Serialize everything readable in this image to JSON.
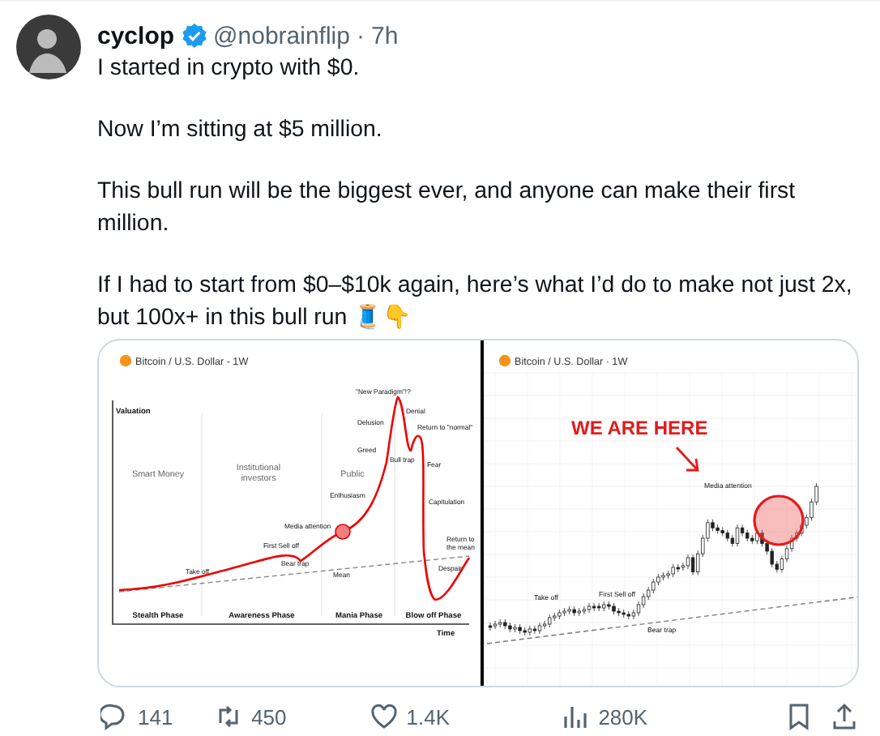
{
  "author": {
    "name": "cyclop",
    "verified": true,
    "handle": "@nobrainflip",
    "dot": "·",
    "time": "7h"
  },
  "paragraphs": [
    "I started in crypto with $0.",
    "Now I’m sitting at $5 million.",
    "This bull run will be the biggest ever, and anyone can make their first million.",
    "If I had to start from $0–$10k again, here’s what I’d do to make not just 2x, but 100x+ in this bull run 🧵👇"
  ],
  "media": [
    {
      "kind": "cycle",
      "title": "Bitcoin / U.S. Dollar - 1W",
      "ylabel": "Valuation",
      "xlabel": "Time",
      "groups": [
        "Smart Money",
        "Institutional investors",
        "Public"
      ],
      "phases": [
        "Stealth Phase",
        "Awareness Phase",
        "Mania Phase",
        "Blow off Phase"
      ],
      "annotations": [
        "\"New Paradigm\"!?",
        "Denial",
        "Delusion",
        "Return to \"normal\"",
        "Greed",
        "Bull trap",
        "Fear",
        "Enthusiasm",
        "Capitulation",
        "Media attention",
        "First Sell off",
        "Return to the mean",
        "Bear trap",
        "Take off",
        "Mean",
        "Despair"
      ]
    },
    {
      "kind": "candles",
      "title": "Bitcoin / U.S. Dollar · 1W",
      "callout": "WE ARE HERE",
      "annotations": [
        "Media attention",
        "Take off",
        "First Sell off",
        "Bear trap"
      ]
    }
  ],
  "actions": [
    {
      "kind": "reply",
      "count": "141"
    },
    {
      "kind": "repost",
      "count": "450"
    },
    {
      "kind": "like",
      "count": "1.4K"
    },
    {
      "kind": "views",
      "count": "280K"
    },
    {
      "kind": "bookmark"
    },
    {
      "kind": "share"
    }
  ]
}
